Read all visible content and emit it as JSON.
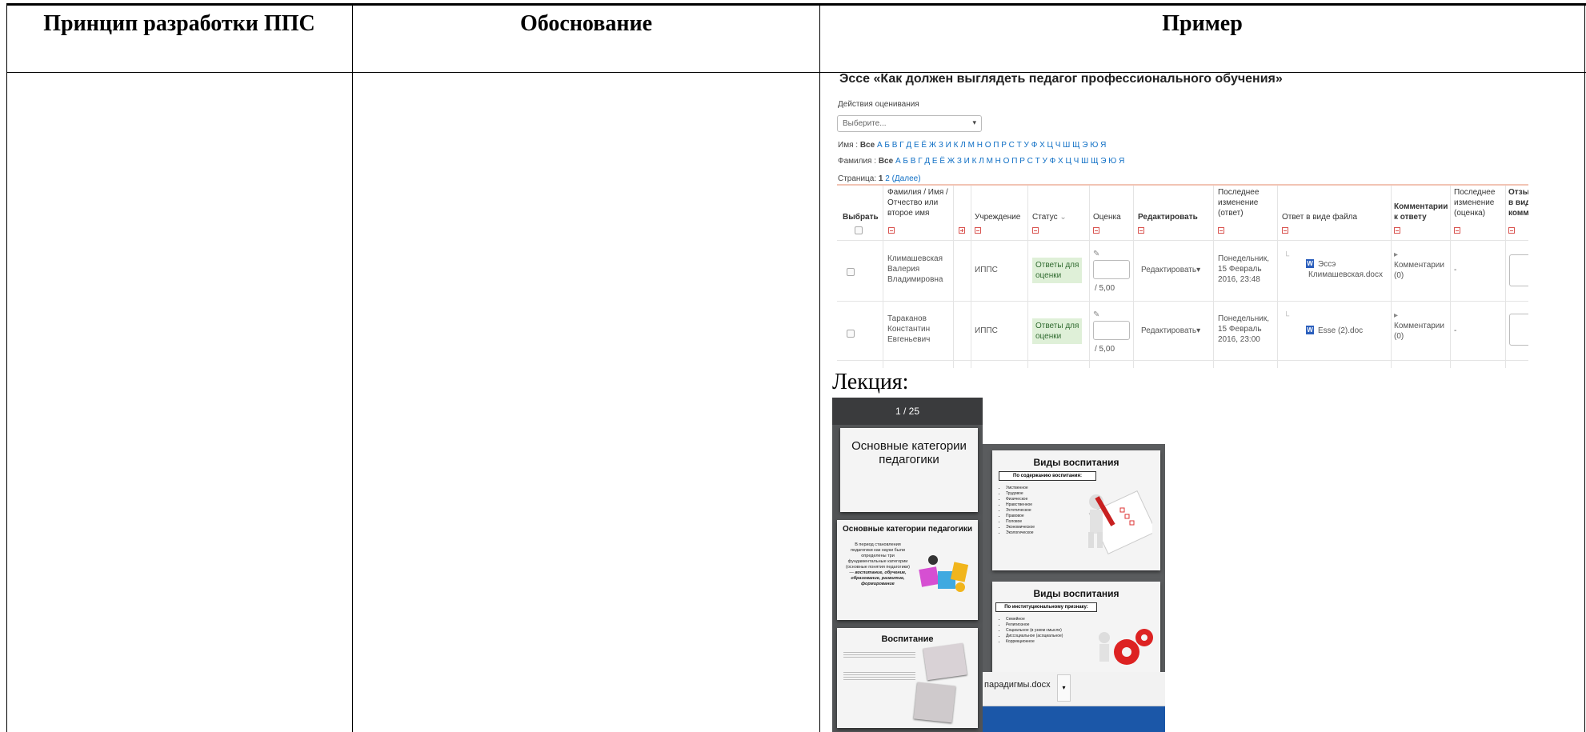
{
  "table": {
    "headers": [
      "Принцип разработки ППС",
      "Обоснование",
      "Пример"
    ]
  },
  "essay": {
    "title": "Эссе «Как должен выглядеть педагог профессионального обучения»",
    "grading_actions_label": "Действия оценивания",
    "select_placeholder": "Выберите...",
    "name_filter_label": "Имя :",
    "surname_filter_label": "Фамилия :",
    "all_label": "Все",
    "letters": "А Б В Г Д Е Ё Ж З И К Л М Н О П Р С Т У Ф Х Ц Ч Ш Щ Э Ю Я",
    "pages_label": "Страница:",
    "current_page": "1",
    "next_page": "2",
    "next_label": "(Далее)",
    "columns": [
      "Выбрать",
      "Фамилия / Имя / Отчество или второе имя",
      "Учреждение",
      "Статус",
      "Оценка",
      "Редактировать",
      "Последнее изменение (ответ)",
      "Ответ в виде файла",
      "Комментарии к ответу",
      "Последнее изменение (оценка)",
      "Отзыв в виде комм"
    ],
    "rows": [
      {
        "name": [
          "Климашевская",
          "Валерия",
          "Владимировна"
        ],
        "institution": "ИППС",
        "status": [
          "Ответы для",
          "оценки"
        ],
        "grade_max": "/ 5,00",
        "edit": "Редактировать",
        "modified": [
          "Понедельник,",
          "15 Февраль",
          "2016, 23:48"
        ],
        "file": [
          "Эссэ",
          "Климашевская.docx"
        ],
        "comments": [
          "Комментарии",
          "(0)"
        ],
        "grade_modified": "-"
      },
      {
        "name": [
          "Тараканов",
          "Константин",
          "Евгеньевич"
        ],
        "institution": "ИППС",
        "status": [
          "Ответы для",
          "оценки"
        ],
        "grade_max": "/ 5,00",
        "edit": "Редактировать",
        "modified": [
          "Понедельник,",
          "15 Февраль",
          "2016, 23:00"
        ],
        "file": [
          "Esse (2).doc"
        ],
        "comments": [
          "Комментарии",
          "(0)"
        ],
        "grade_modified": "-"
      }
    ]
  },
  "lecture": {
    "label": "Лекция:",
    "page_indicator": "1 / 25",
    "slides": {
      "s1_title": "Основные категории педагогики",
      "s2_title": "Основные категории педагогики",
      "s2_text": "В период становления педагогики как науки были определены три фундаментальные категории (основные понятия педагогики) —",
      "s2_bold": "воспитание, обучение, образование, развитие, формирование",
      "s3_title": "Воспитание",
      "s4_title": "Виды воспитания",
      "s4_box": "По содержанию воспитания:",
      "s4_items": [
        "Умственное",
        "Трудовое",
        "Физическое",
        "Нравственное",
        "Эстетическое",
        "Правовое",
        "Половое",
        "Экономическое",
        "Экологическое"
      ],
      "s5_title": "Виды воспитания",
      "s5_box": "По институциональному признаку:",
      "s5_items": [
        "Семейное",
        "Религиозное",
        "Социальное (в узком смысле)",
        "Диссоциальное (асоциальное)",
        "Коррекционное"
      ]
    },
    "taskbar_file": "парадигмы.docx"
  },
  "colors": {
    "accent_link": "#0f6fc5",
    "status_bg": "#dff0d8",
    "viewer_bg": "#525456",
    "taskbar": "#1b57a8"
  }
}
